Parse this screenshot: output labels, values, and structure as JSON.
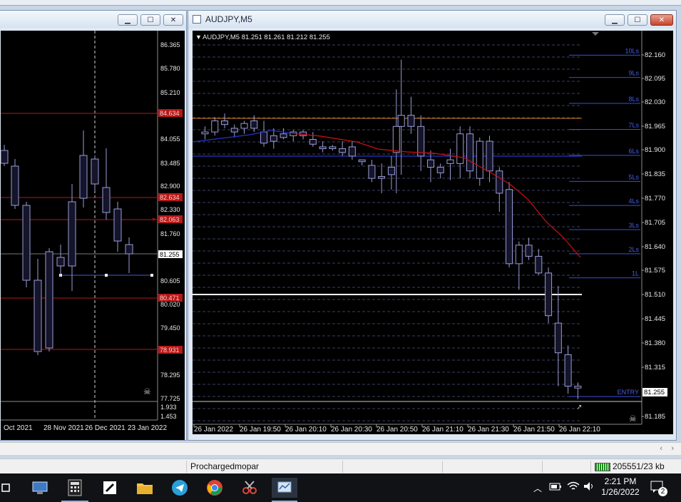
{
  "left_window": {
    "y_axis": [
      "86.365",
      "85.780",
      "85.210",
      "84.634",
      "84.055",
      "83.485",
      "82.900",
      "82.634",
      "82.330",
      "82.063",
      "81.760",
      "81.255",
      "80.605",
      "80.471",
      "80.020",
      "79.450",
      "78.931",
      "78.295",
      "77.725",
      "1.933",
      "1.453"
    ],
    "x_axis": [
      "Oct 2021",
      "28 Nov 2021",
      "26 Dec 2021",
      "23 Jan 2022"
    ],
    "current_price": "81.255"
  },
  "right_window": {
    "title": "AUDJPY,M5",
    "info_line": "AUDJPY,M5  81.251 81.261 81.212 81.255",
    "y_axis": [
      "82.160",
      "82.095",
      "82.030",
      "81.965",
      "81.900",
      "81.835",
      "81.770",
      "81.705",
      "81.640",
      "81.575",
      "81.510",
      "81.445",
      "81.380",
      "81.315",
      "81.255",
      "81.185"
    ],
    "x_axis": [
      "26 Jan 2022",
      "26 Jan 19:50",
      "26 Jan 20:10",
      "26 Jan 20:30",
      "26 Jan 20:50",
      "26 Jan 21:10",
      "26 Jan 21:30",
      "26 Jan 21:50",
      "26 Jan 22:10"
    ],
    "level_labels": [
      "10Ls",
      "9Ls",
      "8Ls",
      "7Ls",
      "6Ls",
      "5Ls",
      "4Ls",
      "3Ls",
      "2Ls",
      "1L",
      "ENTRY"
    ],
    "current_price": "81.255"
  },
  "status_bar": {
    "profile": "Prochargedmopar",
    "traffic": "205551/23 kb"
  },
  "taskbar": {
    "time": "2:21 PM",
    "date": "1/26/2022",
    "notification_count": "2"
  },
  "colors": {
    "chart_bg": "#000000",
    "grid": "#3a3f66",
    "level_line": "#3a4fd6",
    "candle_stroke": "#9b9bd6",
    "ma_red": "#d01010",
    "ma_blue": "#2436c8",
    "orange_line": "#d9821a",
    "red_level": "#b81818"
  }
}
